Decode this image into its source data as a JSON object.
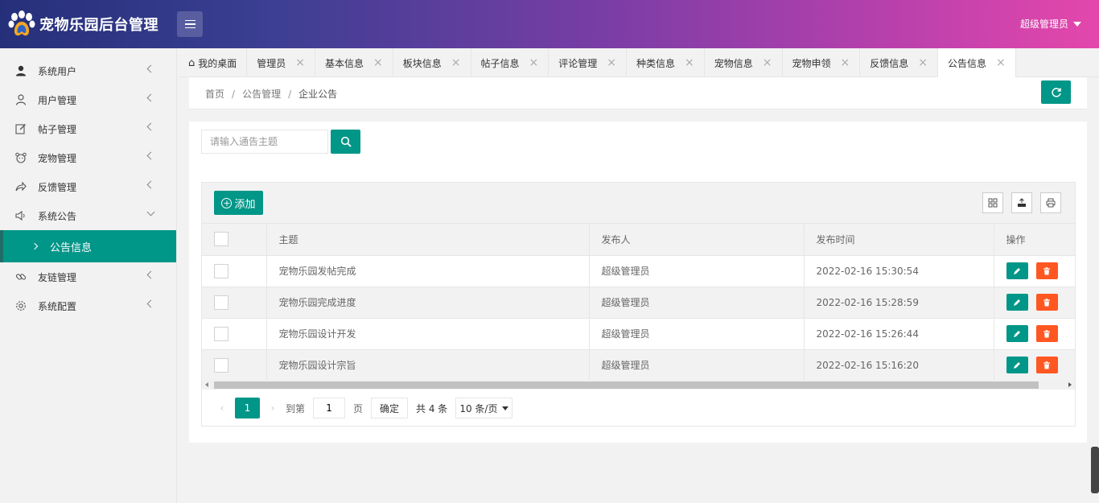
{
  "app": {
    "title": "宠物乐园后台管理"
  },
  "header": {
    "user_label": "超级管理员"
  },
  "sidebar": {
    "items": [
      {
        "label": "系统用户",
        "icon": "user-filled-icon",
        "expanded": false
      },
      {
        "label": "用户管理",
        "icon": "user-icon",
        "expanded": false
      },
      {
        "label": "帖子管理",
        "icon": "edit-icon",
        "expanded": false
      },
      {
        "label": "宠物管理",
        "icon": "pet-icon",
        "expanded": false
      },
      {
        "label": "反馈管理",
        "icon": "share-icon",
        "expanded": false
      },
      {
        "label": "系统公告",
        "icon": "speaker-icon",
        "expanded": true
      },
      {
        "label": "友链管理",
        "icon": "link-icon",
        "expanded": false
      },
      {
        "label": "系统配置",
        "icon": "gear-icon",
        "expanded": false
      }
    ],
    "active_sub": "公告信息"
  },
  "tabs": [
    {
      "label": "我的桌面"
    },
    {
      "label": "管理员"
    },
    {
      "label": "基本信息"
    },
    {
      "label": "板块信息"
    },
    {
      "label": "帖子信息"
    },
    {
      "label": "评论管理"
    },
    {
      "label": "种类信息"
    },
    {
      "label": "宠物信息"
    },
    {
      "label": "宠物申领"
    },
    {
      "label": "反馈信息"
    },
    {
      "label": "公告信息",
      "active": true
    }
  ],
  "breadcrumb": {
    "items": [
      "首页",
      "公告管理",
      "企业公告"
    ]
  },
  "search": {
    "placeholder": "请输入通告主题"
  },
  "toolbar": {
    "add_label": "添加"
  },
  "table": {
    "columns": [
      "主题",
      "发布人",
      "发布时间",
      "操作"
    ],
    "rows": [
      {
        "title": "宠物乐园发帖完成",
        "publisher": "超级管理员",
        "time": "2022-02-16 15:30:54"
      },
      {
        "title": "宠物乐园完成进度",
        "publisher": "超级管理员",
        "time": "2022-02-16 15:28:59"
      },
      {
        "title": "宠物乐园设计开发",
        "publisher": "超级管理员",
        "time": "2022-02-16 15:26:44"
      },
      {
        "title": "宠物乐园设计宗旨",
        "publisher": "超级管理员",
        "time": "2022-02-16 15:16:20"
      }
    ]
  },
  "pager": {
    "current": "1",
    "goto_label": "到第",
    "page_value": "1",
    "page_label": "页",
    "ok_label": "确定",
    "total_label": "共 4 条",
    "page_size": "10 条/页"
  },
  "colors": {
    "primary": "#009688",
    "danger": "#ff5722"
  }
}
